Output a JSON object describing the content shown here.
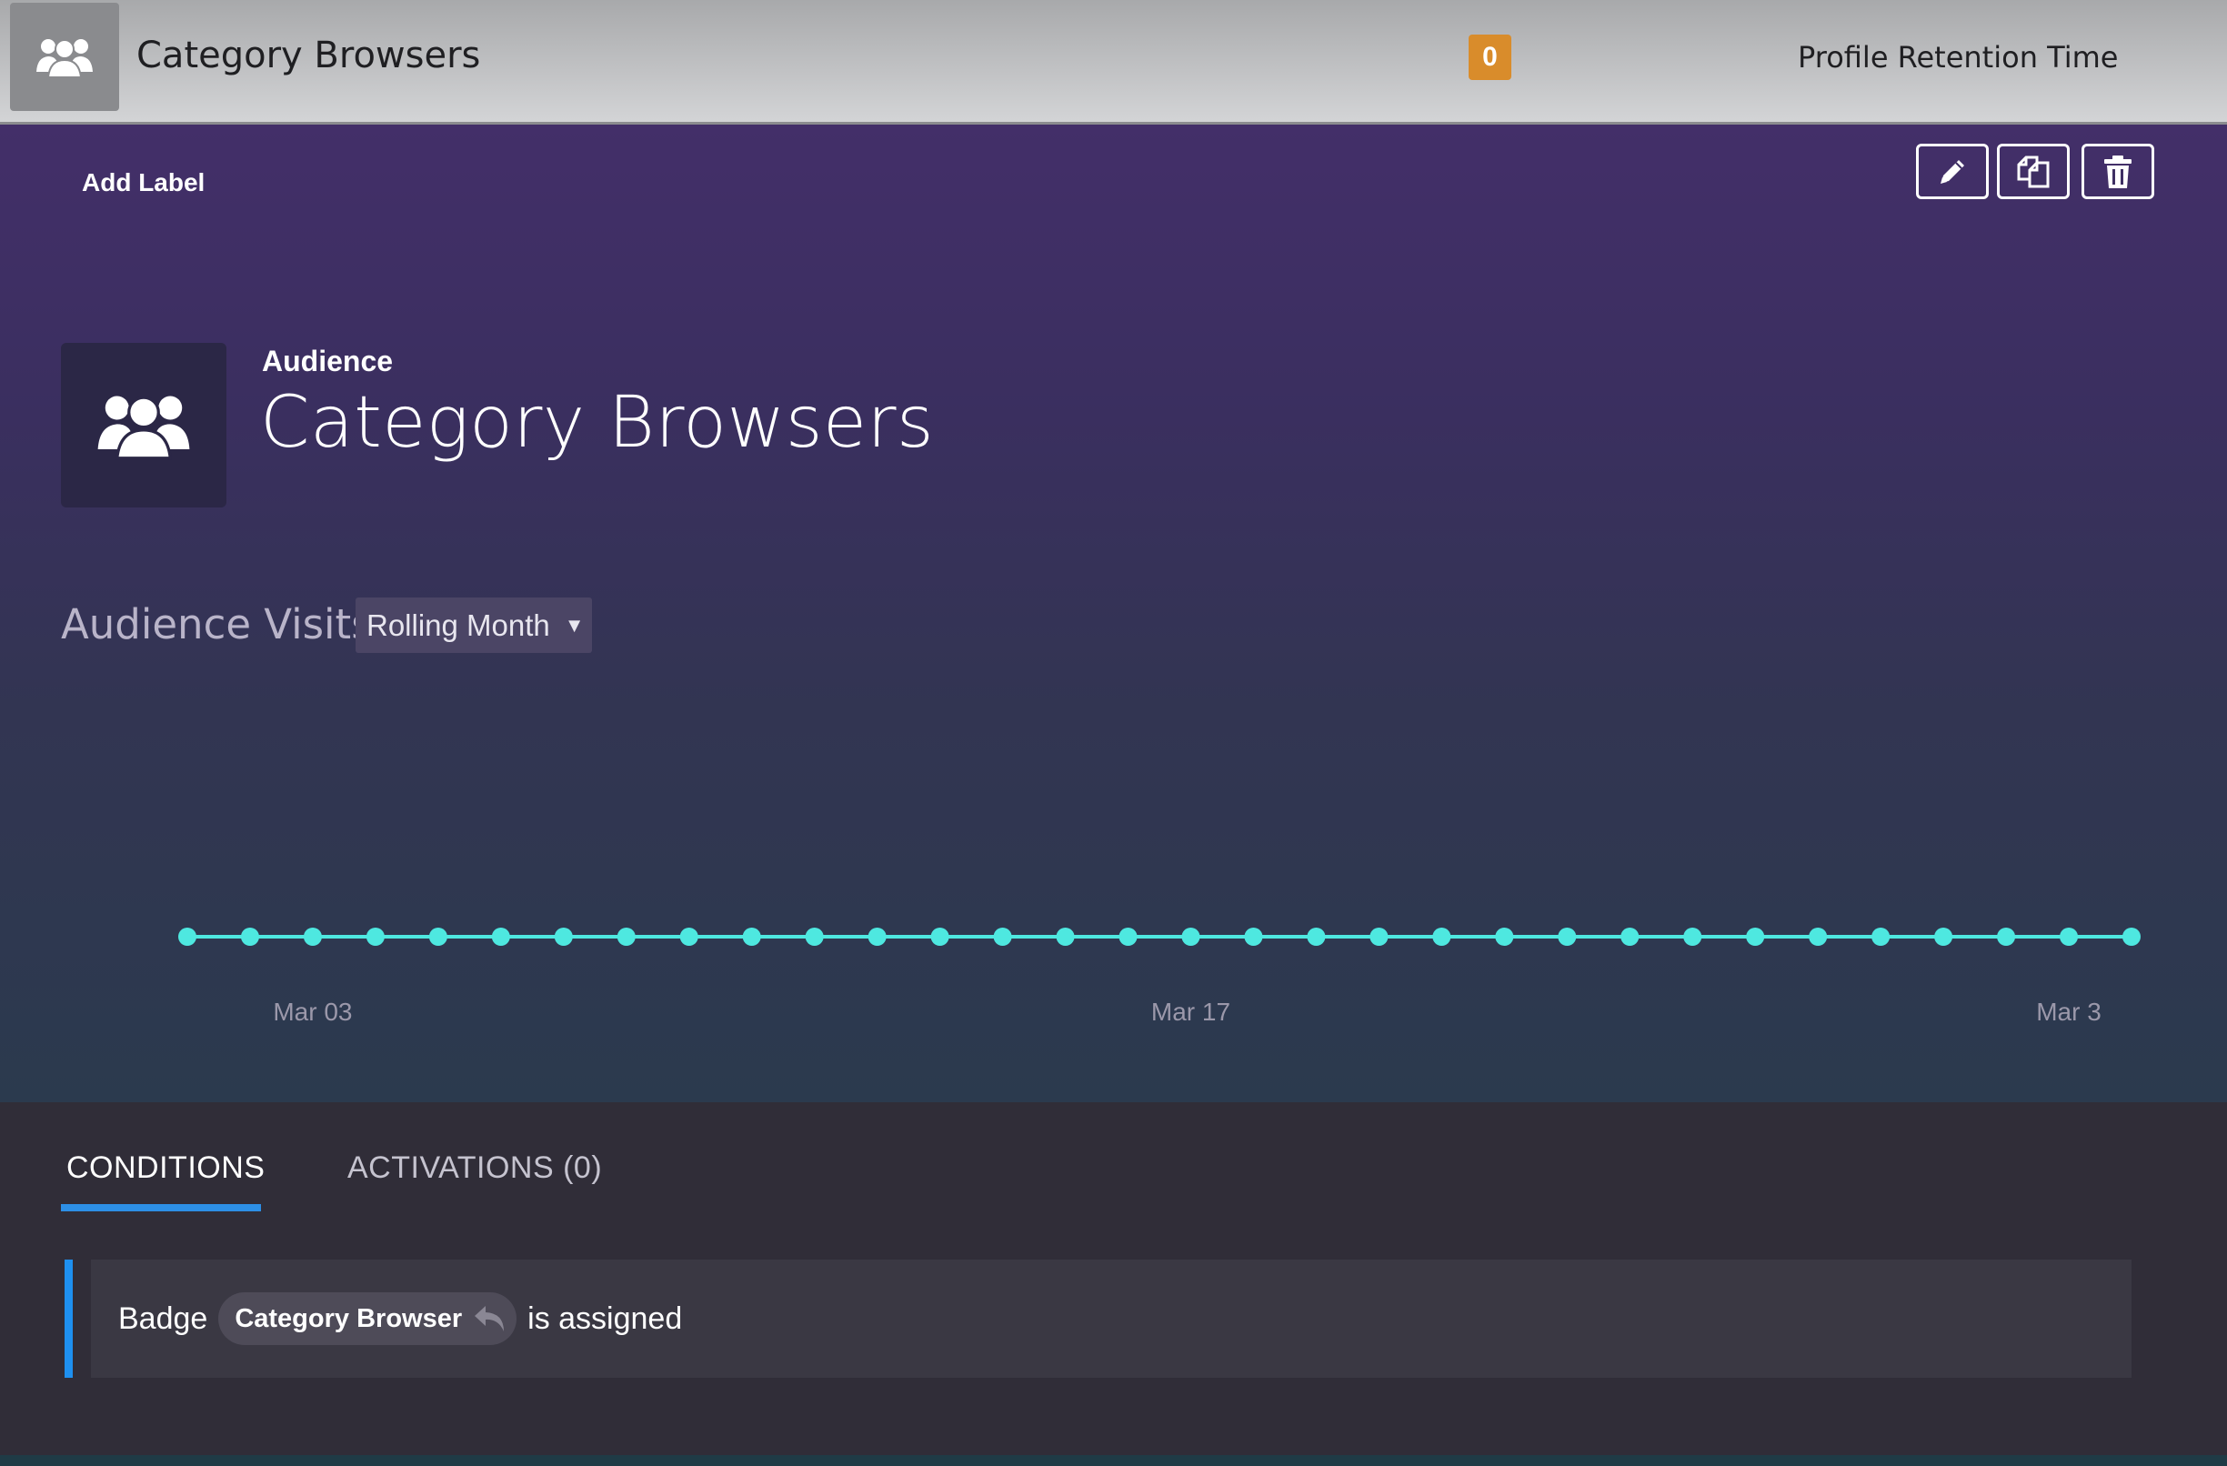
{
  "topbar": {
    "title": "Category Browsers",
    "count": "0",
    "retention_label": "Profile Retention Time",
    "icon": "users-icon"
  },
  "toolbar": {
    "add_label": "Add Label",
    "buttons": [
      "pencil-icon",
      "copy-icon",
      "trash-icon"
    ]
  },
  "audience": {
    "kicker": "Audience",
    "title": "Category Browsers",
    "icon": "users-icon"
  },
  "visits": {
    "label": "Audience Visits",
    "range": "Rolling Month"
  },
  "chart_data": {
    "type": "line",
    "color": "#4ee8e0",
    "x_tick_labels": [
      "Mar 03",
      "Mar 17",
      "Mar 3"
    ],
    "values": [
      0,
      0,
      0,
      0,
      0,
      0,
      0,
      0,
      0,
      0,
      0,
      0,
      0,
      0,
      0,
      0,
      0,
      0,
      0,
      0,
      0,
      0,
      0,
      0,
      0,
      0,
      0,
      0,
      0,
      0,
      0,
      0
    ]
  },
  "tabs": {
    "conditions": "CONDITIONS",
    "activations": "ACTIVATIONS (0)"
  },
  "condition": {
    "prefix": "Badge",
    "badge": "Category Browser",
    "suffix": "is assigned"
  },
  "colors": {
    "accent": "#2d8fe6",
    "badge": "#d98c2b",
    "chart_line": "#4ee8e0"
  }
}
